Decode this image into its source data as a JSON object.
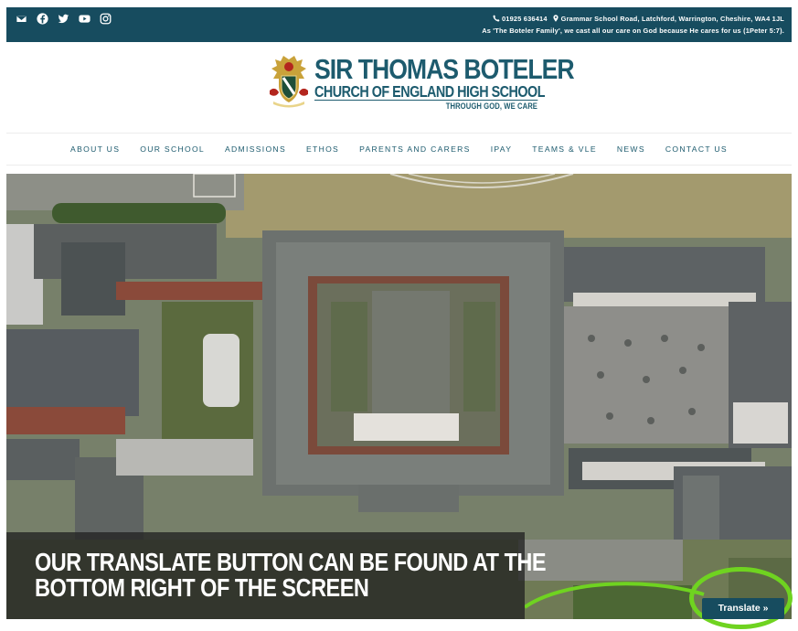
{
  "topbar": {
    "social_icons": [
      "envelope-icon",
      "facebook-icon",
      "twitter-icon",
      "youtube-icon",
      "instagram-icon"
    ],
    "phone": "01925 636414",
    "address": "Grammar School Road, Latchford, Warrington, Cheshire, WA4 1JL",
    "motto_line": "As 'The Boteler Family', we cast all our care on God because He cares for us (1Peter 5:7)."
  },
  "logo": {
    "line1": "SIR THOMAS BOTELER",
    "line2": "CHURCH OF ENGLAND HIGH SCHOOL",
    "tagline": "THROUGH GOD, WE CARE"
  },
  "nav": {
    "items": [
      "ABOUT US",
      "OUR SCHOOL",
      "ADMISSIONS",
      "ETHOS",
      "PARENTS AND CARERS",
      "IPAY",
      "TEAMS & VLE",
      "NEWS",
      "CONTACT US"
    ]
  },
  "hero": {
    "caption_line1": "OUR TRANSLATE BUTTON CAN BE FOUND AT THE",
    "caption_line2": "BOTTOM RIGHT OF THE SCREEN"
  },
  "translate": {
    "label": "Translate »"
  },
  "colors": {
    "brand_teal": "#174c5f",
    "highlight_green": "#6fd320"
  }
}
